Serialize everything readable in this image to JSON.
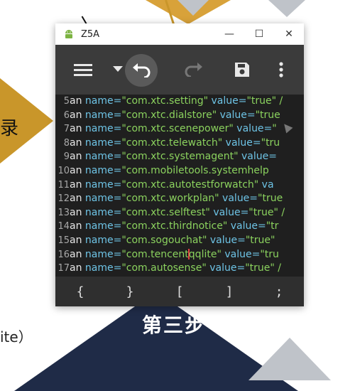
{
  "slide": {
    "left_text": "录",
    "bottom_text": "ite）",
    "step_label": "第三步"
  },
  "window": {
    "title": "Z5A",
    "controls": {
      "minimize": "—",
      "maximize": "☐",
      "close": "✕"
    }
  },
  "toolbar": {
    "icons": [
      "menu-icon",
      "dropdown-icon",
      "undo-icon",
      "redo-icon",
      "save-icon",
      "more-vert-icon"
    ],
    "redo_enabled": false
  },
  "editor": {
    "lines": [
      {
        "num": "5",
        "kw": "an",
        "attr": " name=",
        "val": "\"com.xtc.setting\"",
        "attr2": " value=",
        "val2": "\"true\" /"
      },
      {
        "num": "6",
        "kw": "an",
        "attr": " name=",
        "val": "\"com.xtc.dialstore\"",
        "attr2": " value=",
        "val2": "\"true"
      },
      {
        "num": "7",
        "kw": "an",
        "attr": " name=",
        "val": "\"com.xtc.scenepower\"",
        "attr2": " value=",
        "val2": "\""
      },
      {
        "num": "8",
        "kw": "an",
        "attr": " name=",
        "val": "\"com.xtc.telewatch\"",
        "attr2": " value=",
        "val2": "\"tru"
      },
      {
        "num": "9",
        "kw": "an",
        "attr": " name=",
        "val": "\"com.xtc.systemagent\"",
        "attr2": " value=",
        "val2": ""
      },
      {
        "num": "10",
        "kw": "an",
        "attr": " name=",
        "val": "\"com.mobiletools.systemhelp",
        "attr2": "",
        "val2": ""
      },
      {
        "num": "11",
        "kw": "an",
        "attr": " name=",
        "val": "\"com.xtc.autotestforwatch\"",
        "attr2": " va",
        "val2": ""
      },
      {
        "num": "12",
        "kw": "an",
        "attr": " name=",
        "val": "\"com.xtc.workplan\"",
        "attr2": " value=",
        "val2": "\"true"
      },
      {
        "num": "13",
        "kw": "an",
        "attr": " name=",
        "val": "\"com.xtc.selftest\"",
        "attr2": " value=",
        "val2": "\"true\" /"
      },
      {
        "num": "14",
        "kw": "an",
        "attr": " name=",
        "val": "\"com.xtc.thirdnotice\"",
        "attr2": " value=",
        "val2": "\"tr"
      },
      {
        "num": "15",
        "kw": "an",
        "attr": " name=",
        "val": "\"com.sogouchat\"",
        "attr2": " value=",
        "val2": "\"true\""
      },
      {
        "num": "16",
        "kw": "an",
        "attr": " name=",
        "val": "\"com.tencent",
        "val_after_cursor": "qqlite\"",
        "attr2": " value=",
        "val2": "\"tru"
      },
      {
        "num": "17",
        "kw": "an",
        "attr": " name=",
        "val": "\"com.autosense\"",
        "attr2": " value=",
        "val2": "\"true\" /"
      }
    ]
  },
  "bracket_bar": {
    "keys": [
      "{",
      "}",
      "[",
      "]",
      ";"
    ]
  }
}
